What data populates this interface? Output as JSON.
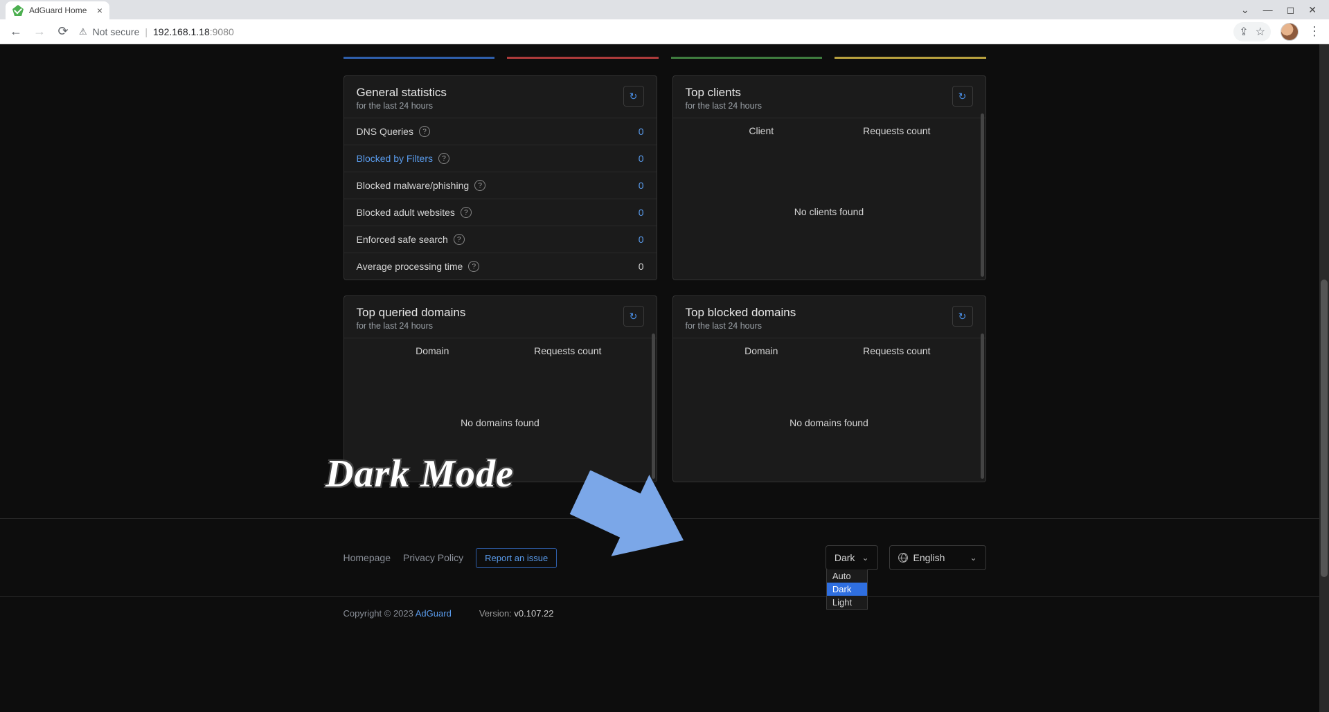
{
  "browser": {
    "tab_title": "AdGuard Home",
    "not_secure": "Not secure",
    "url_host": "192.168.1.18",
    "url_port": ":9080"
  },
  "accents": [
    "#2f5fac",
    "#ad3b3b",
    "#3f7d3f",
    "#b8a13e"
  ],
  "stats": {
    "title": "General statistics",
    "sub": "for the last 24 hours",
    "rows": [
      {
        "label": "DNS Queries",
        "val": "0",
        "link": false,
        "plain": false
      },
      {
        "label": "Blocked by Filters",
        "val": "0",
        "link": true,
        "plain": false
      },
      {
        "label": "Blocked malware/phishing",
        "val": "0",
        "link": false,
        "plain": false
      },
      {
        "label": "Blocked adult websites",
        "val": "0",
        "link": false,
        "plain": false
      },
      {
        "label": "Enforced safe search",
        "val": "0",
        "link": false,
        "plain": false
      },
      {
        "label": "Average processing time",
        "val": "0",
        "link": false,
        "plain": true
      }
    ]
  },
  "top_clients": {
    "title": "Top clients",
    "sub": "for the last 24 hours",
    "col1": "Client",
    "col2": "Requests count",
    "empty": "No clients found"
  },
  "top_queried": {
    "title": "Top queried domains",
    "sub": "for the last 24 hours",
    "col1": "Domain",
    "col2": "Requests count",
    "empty": "No domains found"
  },
  "top_blocked": {
    "title": "Top blocked domains",
    "sub": "for the last 24 hours",
    "col1": "Domain",
    "col2": "Requests count",
    "empty": "No domains found"
  },
  "footer": {
    "homepage": "Homepage",
    "privacy": "Privacy Policy",
    "report": "Report an issue",
    "theme_label": "Dark",
    "theme_options": [
      "Auto",
      "Dark",
      "Light"
    ],
    "theme_selected": "Dark",
    "lang": "English",
    "copyright_prefix": "Copyright © 2023 ",
    "brand": "AdGuard",
    "version_label": "Version: ",
    "version": "v0.107.22"
  },
  "annotation": "Dark Mode"
}
